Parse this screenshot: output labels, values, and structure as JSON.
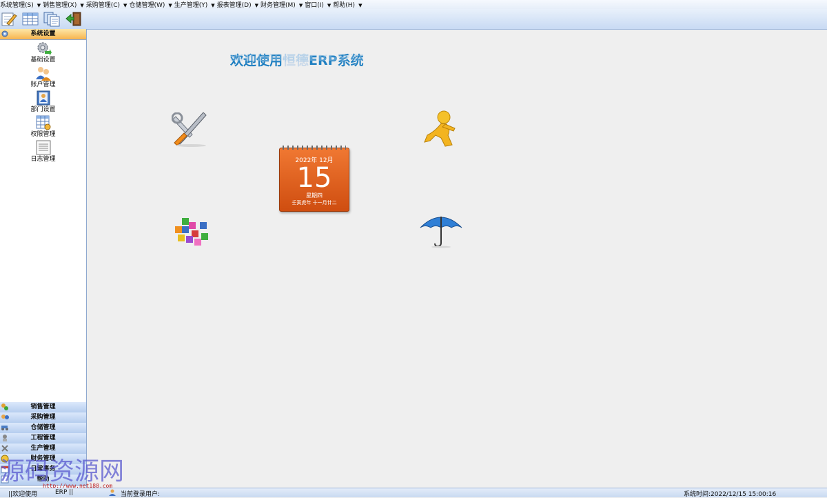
{
  "menu": [
    {
      "label": "系统管理(S)"
    },
    {
      "label": "销售管理(X)"
    },
    {
      "label": "采购管理(C)"
    },
    {
      "label": "仓储管理(W)"
    },
    {
      "label": "生产管理(Y)"
    },
    {
      "label": "报表管理(D)"
    },
    {
      "label": "财务管理(M)"
    },
    {
      "label": "窗口(I)"
    },
    {
      "label": "帮助(H)"
    }
  ],
  "toolbar": {
    "buttons": [
      {
        "icon": "edit-icon"
      },
      {
        "icon": "table-icon"
      },
      {
        "icon": "copy-icon"
      },
      {
        "icon": "exit-icon"
      }
    ]
  },
  "sidebar": {
    "active_group": "系统设置",
    "items": [
      {
        "label": "基础设置",
        "icon": "gear-icon"
      },
      {
        "label": "账户管理",
        "icon": "users-icon"
      },
      {
        "label": "部门设置",
        "icon": "department-icon"
      },
      {
        "label": "权限管理",
        "icon": "permission-icon"
      },
      {
        "label": "日志管理",
        "icon": "log-icon"
      }
    ],
    "groups": [
      {
        "label": "销售管理"
      },
      {
        "label": "采购管理"
      },
      {
        "label": "仓储管理"
      },
      {
        "label": "工程管理"
      },
      {
        "label": "生产管理"
      },
      {
        "label": "财务管理"
      },
      {
        "label": "日常事务"
      },
      {
        "label": "帮助"
      }
    ]
  },
  "main": {
    "welcome_prefix": "欢迎使用",
    "welcome_hidden": "恒德",
    "welcome_suffix": "ERP系统",
    "calendar": {
      "year_month": "2022年  12月",
      "day": "15",
      "weekday": "星期四",
      "lunar": "壬寅虎年  十一月廿二"
    }
  },
  "status": {
    "left": "||欢迎使用",
    "left2": "ERP ||",
    "user_label": "当前登录用户:",
    "time_label": "系统时间:2022/12/15  15:00:16"
  },
  "watermark": {
    "text": "源码资源网",
    "url": "http://www.net188.com"
  },
  "colors": {
    "accent": "#1f7fc1",
    "calendar": "#e0601f",
    "active_group": "#f7b44e"
  }
}
